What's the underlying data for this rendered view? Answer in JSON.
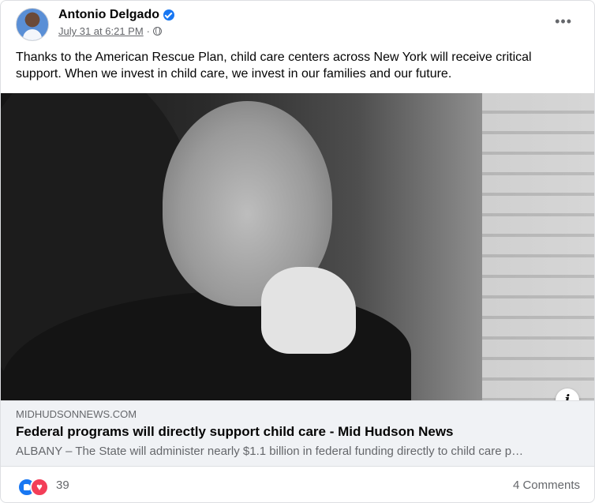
{
  "post": {
    "author": "Antonio Delgado",
    "timestamp": "July 31 at 6:21 PM",
    "separator": "·",
    "privacy_icon": "globe-icon",
    "more_label": "•••",
    "text": "Thanks to the American Rescue Plan, child care centers across New York will receive critical support. When we invest in child care, we invest in our families and our future."
  },
  "link_preview": {
    "domain": "MIDHUDSONNEWS.COM",
    "title": "Federal programs will directly support child care - Mid Hudson News",
    "description": "ALBANY – The State will administer nearly $1.1 billion in federal funding directly to child care p…",
    "info_label": "i"
  },
  "footer": {
    "reaction_count": "39",
    "comments_label": "4 Comments",
    "reactions": [
      "like-icon",
      "love-icon"
    ]
  },
  "colors": {
    "accent": "#1877f2",
    "love": "#f33e58",
    "secondary_text": "#65676b",
    "link_bg": "#f0f2f5"
  }
}
